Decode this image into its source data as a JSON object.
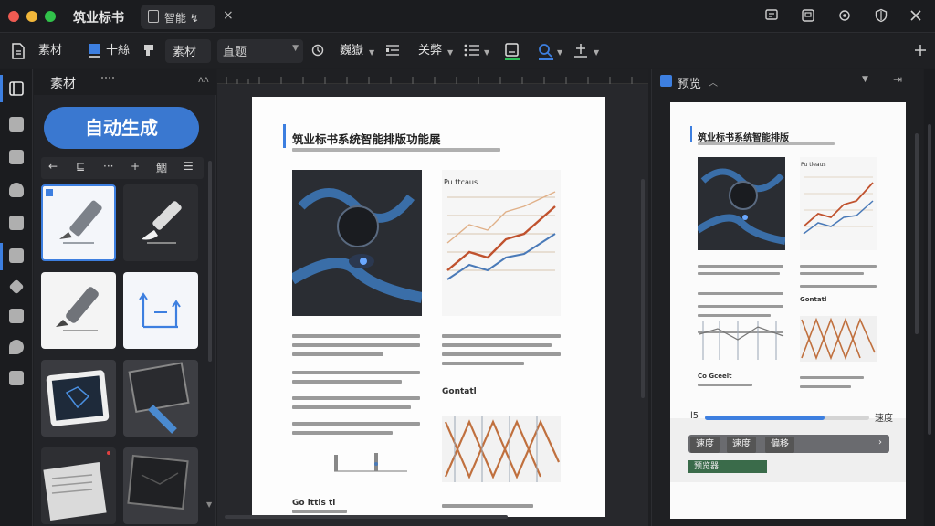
{
  "app": {
    "title": "筑业标书",
    "doc_tab": "智能 ↯",
    "close_tab": "×"
  },
  "window": {
    "icons": [
      "message-icon",
      "export-icon",
      "settings-icon",
      "shield-icon",
      "close-icon"
    ]
  },
  "toolbar": {
    "material_label": "素材",
    "font_label": "十絲",
    "material_box": "素材",
    "style_select": "直题",
    "layout_label": "巍嶽",
    "extra_label": "关弊"
  },
  "panel": {
    "title": "素材",
    "generate_button": "自动生成",
    "subbar": [
      "←",
      "⊑",
      "···",
      "+",
      "鯝",
      "☰"
    ]
  },
  "document": {
    "title": "筑业标书系统智能排版功能展",
    "section_label": "Gontatl",
    "footer_label": "Go lttis tl"
  },
  "preview": {
    "title": "预览",
    "doc_title": "筑业标书系统智能排版",
    "chart_label": "Pu tleaus",
    "section_label": "Gontatl",
    "footer_label": "Co Gceelt",
    "progress_label": "l5",
    "progress_end": "速度",
    "progress_value": 0.73,
    "chips": [
      "速度",
      "速度",
      "偏移"
    ],
    "bottom_chip": "预览器"
  },
  "colors": {
    "accent": "#3d7fe0",
    "background": "#1e1f22",
    "panel": "#222327"
  }
}
